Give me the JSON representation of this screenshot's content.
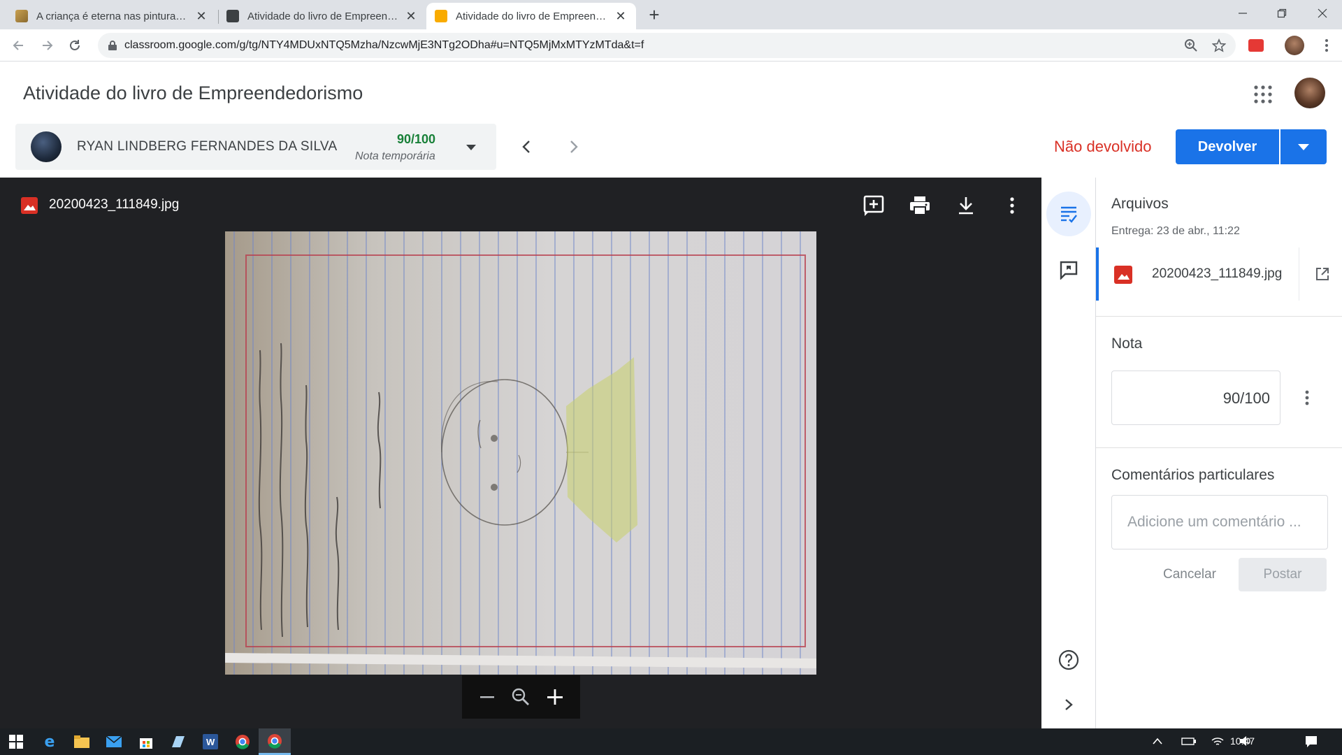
{
  "browser": {
    "tabs": [
      {
        "title": "A criança é eterna nas pinturas de",
        "favicon": "painting-favicon",
        "active": false
      },
      {
        "title": "Atividade do livro de Empreendedorismo",
        "favicon": "classroom-favicon",
        "active": false
      },
      {
        "title": "Atividade do livro de Empreendedorismo",
        "favicon": "classroom-favicon",
        "active": true
      }
    ],
    "url": "classroom.google.com/g/tg/NTY4MDUxNTQ5Mzha/NzcwMjE3NTg2ODha#u=NTQ5MjMxMTYzMTda&t=f"
  },
  "header": {
    "title": "Atividade do livro de Empreendedorismo"
  },
  "student": {
    "name": "RYAN LINDBERG FERNANDES DA SILVA",
    "grade": "90/100",
    "grade_note": "Nota temporária"
  },
  "status": "Não devolvido",
  "return_button": "Devolver",
  "viewer": {
    "filename": "20200423_111849.jpg",
    "tools": [
      "add-comment-icon",
      "print-icon",
      "download-icon",
      "more-vert-icon"
    ],
    "zoom_tools": [
      "zoom-out-icon",
      "zoom-reset-icon",
      "zoom-in-icon"
    ]
  },
  "panel": {
    "files_title": "Arquivos",
    "submitted": "Entrega: 23 de abr., 11:22",
    "file": "20200423_111849.jpg",
    "grade_title": "Nota",
    "grade_value": "90/100",
    "comments_title": "Comentários particulares",
    "comment_placeholder": "Adicione um comentário ...",
    "cancel": "Cancelar",
    "post": "Postar"
  },
  "taskbar": {
    "time": "10:47",
    "apps": [
      "windows-start-icon",
      "edge-icon",
      "file-explorer-icon",
      "mail-icon",
      "store-icon",
      "photos-icon",
      "word-icon",
      "chrome-icon",
      "chrome-active-icon"
    ]
  },
  "colors": {
    "accent": "#1a73e8",
    "status_red": "#d93025",
    "grade_green": "#188038",
    "viewer_bg": "#202124"
  }
}
